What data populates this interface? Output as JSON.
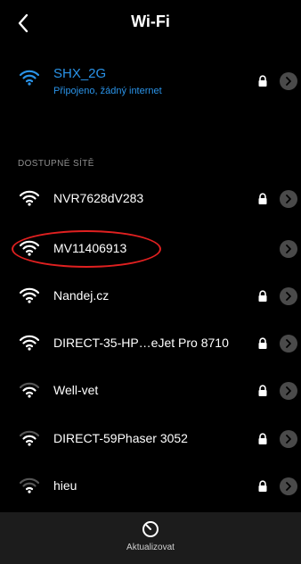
{
  "header": {
    "title": "Wi-Fi"
  },
  "connected": {
    "ssid": "SHX_2G",
    "status": "Připojeno, žádný internet",
    "locked": true,
    "accent": "#2a93e8"
  },
  "available": {
    "section_label": "DOSTUPNÉ SÍTĚ",
    "networks": [
      {
        "ssid": "NVR7628dV283",
        "locked": true,
        "signal": 4
      },
      {
        "ssid": "MV11406913",
        "locked": false,
        "signal": 4,
        "highlighted": true
      },
      {
        "ssid": "Nandej.cz",
        "locked": true,
        "signal": 4
      },
      {
        "ssid": "DIRECT-35-HP…eJet Pro 8710",
        "locked": true,
        "signal": 4
      },
      {
        "ssid": "Well-vet",
        "locked": true,
        "signal": 3
      },
      {
        "ssid": "DIRECT-59Phaser 3052",
        "locked": true,
        "signal": 3
      },
      {
        "ssid": "hieu",
        "locked": true,
        "signal": 2
      }
    ]
  },
  "bottom_bar": {
    "refresh_label": "Aktualizovat"
  },
  "annotation": {
    "color": "#e02020"
  }
}
